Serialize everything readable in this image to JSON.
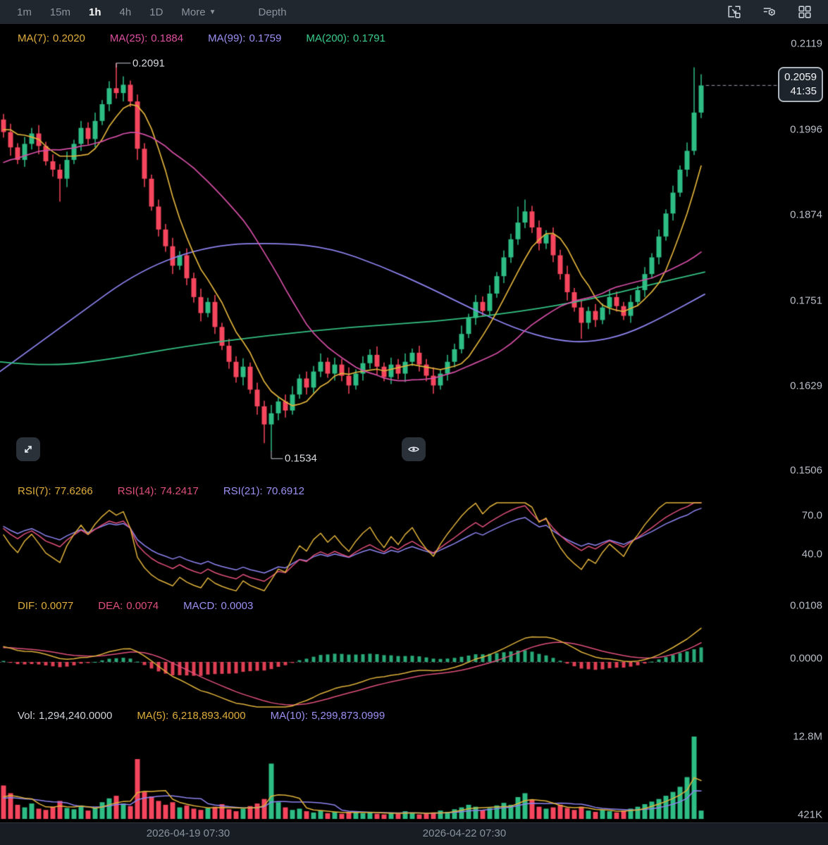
{
  "toolbar": {
    "timeframes": [
      {
        "label": "1m",
        "active": false
      },
      {
        "label": "15m",
        "active": false
      },
      {
        "label": "1h",
        "active": true
      },
      {
        "label": "4h",
        "active": false
      },
      {
        "label": "1D",
        "active": false
      }
    ],
    "more_label": "More",
    "depth_label": "Depth"
  },
  "main_chart": {
    "indicators": [
      {
        "label": "MA(7):",
        "value": "0.2020"
      },
      {
        "label": "MA(25):",
        "value": "0.1884"
      },
      {
        "label": "MA(99):",
        "value": "0.1759"
      },
      {
        "label": "MA(200):",
        "value": "0.1791"
      }
    ],
    "price_axis": [
      "0.2119",
      "0.1996",
      "0.1874",
      "0.1751",
      "0.1629",
      "0.1506"
    ],
    "annotations": {
      "high": "0.2091",
      "low": "0.1534"
    },
    "last_price": {
      "price": "0.2059",
      "countdown": "41:35"
    }
  },
  "rsi": {
    "indicators": [
      {
        "label": "RSI(7):",
        "value": "77.6266"
      },
      {
        "label": "RSI(14):",
        "value": "74.2417"
      },
      {
        "label": "RSI(21):",
        "value": "70.6912"
      }
    ],
    "axis": [
      "70.0",
      "40.0"
    ]
  },
  "macd": {
    "indicators": [
      {
        "label": "DIF:",
        "value": "0.0077"
      },
      {
        "label": "DEA:",
        "value": "0.0074"
      },
      {
        "label": "MACD:",
        "value": "0.0003"
      }
    ],
    "axis": [
      "0.0108",
      "0.0000"
    ]
  },
  "volume": {
    "indicators": [
      {
        "label": "Vol:",
        "value": "1,294,240.0000"
      },
      {
        "label": "MA(5):",
        "value": "6,218,893.4000"
      },
      {
        "label": "MA(10):",
        "value": "5,299,873.0999"
      }
    ],
    "axis": [
      "12.8M",
      "421K"
    ]
  },
  "time_axis": [
    "2026-04-19 07:30",
    "2026-04-22 07:30"
  ],
  "colors": {
    "up": "#2ebd85",
    "down": "#f6465d",
    "ma7": "#e0b23c",
    "ma25": "#d44fa6",
    "ma99": "#8d84f0",
    "ma200": "#35c183",
    "rsi7": "#e0b23c",
    "rsi14": "#e0507c",
    "rsi21": "#8d84f0",
    "dif": "#e0b23c",
    "dea": "#e0507c",
    "vol_ma5": "#e0b23c",
    "vol_ma10": "#8d84f0",
    "axis_text": "#b7bdc6",
    "annotation_line": "#c8cdd3"
  },
  "chart_data": {
    "type": "candlestick",
    "interval": "1h",
    "price_axis_values": [
      0.2119,
      0.1996,
      0.1874,
      0.1751,
      0.1629,
      0.1506
    ],
    "period_high": 0.2091,
    "period_low": 0.1534,
    "last_price": 0.2059,
    "rsi_axis_values": [
      70.0,
      40.0
    ],
    "macd_axis_values": [
      0.0108,
      0.0
    ],
    "volume_axis_max_millions": 12.8,
    "time_ticks": [
      "2026-04-19 07:30",
      "2026-04-22 07:30"
    ],
    "open": [
      0.201,
      0.1992,
      0.197,
      0.1952,
      0.1975,
      0.199,
      0.1972,
      0.195,
      0.1938,
      0.1925,
      0.1952,
      0.1975,
      0.1998,
      0.1982,
      0.2008,
      0.2032,
      0.2055,
      0.2048,
      0.206,
      0.2036,
      0.1968,
      0.1925,
      0.1885,
      0.1852,
      0.1828,
      0.18,
      0.1815,
      0.1782,
      0.1755,
      0.1732,
      0.1748,
      0.1712,
      0.1685,
      0.1662,
      0.164,
      0.1655,
      0.1622,
      0.1598,
      0.1572,
      0.1588,
      0.1605,
      0.1592,
      0.1615,
      0.1638,
      0.1625,
      0.1648,
      0.1662,
      0.1645,
      0.1658,
      0.1642,
      0.1628,
      0.1645,
      0.166,
      0.1672,
      0.1655,
      0.164,
      0.1658,
      0.1645,
      0.1662,
      0.1675,
      0.1658,
      0.1642,
      0.1628,
      0.1645,
      0.1662,
      0.168,
      0.1702,
      0.1725,
      0.1748,
      0.1735,
      0.176,
      0.1785,
      0.1812,
      0.1838,
      0.1862,
      0.1878,
      0.1855,
      0.1832,
      0.1845,
      0.1815,
      0.1788,
      0.1762,
      0.174,
      0.1718,
      0.1735,
      0.1722,
      0.174,
      0.1755,
      0.1742,
      0.1728,
      0.1748,
      0.1765,
      0.1788,
      0.1812,
      0.1842,
      0.1875,
      0.1905,
      0.1938,
      0.1965,
      0.202
    ],
    "high": [
      0.2018,
      0.2004,
      0.1976,
      0.1985,
      0.1998,
      0.2002,
      0.1978,
      0.196,
      0.1946,
      0.1964,
      0.1981,
      0.2008,
      0.2006,
      0.202,
      0.2038,
      0.2065,
      0.2091,
      0.2072,
      0.2066,
      0.2046,
      0.1976,
      0.1931,
      0.1895,
      0.186,
      0.184,
      0.1821,
      0.1825,
      0.179,
      0.1767,
      0.1754,
      0.1758,
      0.1718,
      0.1695,
      0.167,
      0.1667,
      0.1661,
      0.1632,
      0.1606,
      0.16,
      0.1611,
      0.1615,
      0.1627,
      0.1644,
      0.1648,
      0.1656,
      0.1674,
      0.1668,
      0.1668,
      0.1666,
      0.1654,
      0.1651,
      0.167,
      0.168,
      0.1684,
      0.1661,
      0.1668,
      0.1666,
      0.1674,
      0.1681,
      0.1685,
      0.1666,
      0.1654,
      0.1651,
      0.1672,
      0.1688,
      0.1714,
      0.1731,
      0.1758,
      0.1756,
      0.1772,
      0.1791,
      0.1822,
      0.1846,
      0.1885,
      0.1895,
      0.1886,
      0.1865,
      0.1851,
      0.1855,
      0.1823,
      0.18,
      0.1768,
      0.175,
      0.1741,
      0.1745,
      0.1746,
      0.1765,
      0.1763,
      0.1748,
      0.1758,
      0.1771,
      0.1798,
      0.1818,
      0.1852,
      0.1881,
      0.1915,
      0.1944,
      0.1977,
      0.2085,
      0.2075
    ],
    "low": [
      0.1984,
      0.1958,
      0.1946,
      0.1942,
      0.1967,
      0.196,
      0.1944,
      0.1928,
      0.1892,
      0.1913,
      0.1946,
      0.1965,
      0.1974,
      0.197,
      0.2002,
      0.2022,
      0.204,
      0.2036,
      0.2028,
      0.1952,
      0.1913,
      0.1879,
      0.1842,
      0.182,
      0.1788,
      0.1794,
      0.1772,
      0.1747,
      0.172,
      0.1726,
      0.1702,
      0.1679,
      0.1652,
      0.1632,
      0.1628,
      0.1616,
      0.1586,
      0.1545,
      0.1534,
      0.1578,
      0.1582,
      0.1586,
      0.1609,
      0.1615,
      0.1617,
      0.164,
      0.1639,
      0.1635,
      0.1634,
      0.1616,
      0.1622,
      0.1635,
      0.1652,
      0.1643,
      0.1634,
      0.163,
      0.1637,
      0.1633,
      0.1656,
      0.1648,
      0.1634,
      0.1616,
      0.1622,
      0.1635,
      0.1654,
      0.1674,
      0.1696,
      0.1715,
      0.1727,
      0.1729,
      0.1754,
      0.1775,
      0.1804,
      0.183,
      0.1854,
      0.1847,
      0.1822,
      0.1824,
      0.1805,
      0.178,
      0.175,
      0.1734,
      0.1695,
      0.1709,
      0.1712,
      0.1716,
      0.173,
      0.1734,
      0.1722,
      0.1718,
      0.1742,
      0.1755,
      0.1782,
      0.1802,
      0.1836,
      0.1865,
      0.1899,
      0.1928,
      0.1959,
      0.2012
    ],
    "close": [
      0.1992,
      0.197,
      0.1952,
      0.1975,
      0.199,
      0.1972,
      0.195,
      0.1938,
      0.1925,
      0.1952,
      0.1975,
      0.1998,
      0.1982,
      0.2008,
      0.2032,
      0.2055,
      0.2048,
      0.206,
      0.2036,
      0.1968,
      0.1925,
      0.1885,
      0.1852,
      0.1828,
      0.18,
      0.1815,
      0.1782,
      0.1755,
      0.1732,
      0.1748,
      0.1712,
      0.1685,
      0.1662,
      0.164,
      0.1655,
      0.1622,
      0.1598,
      0.1572,
      0.1588,
      0.1605,
      0.1592,
      0.1615,
      0.1638,
      0.1625,
      0.1648,
      0.1662,
      0.1645,
      0.1658,
      0.1642,
      0.1628,
      0.1645,
      0.166,
      0.1672,
      0.1655,
      0.164,
      0.1658,
      0.1645,
      0.1662,
      0.1675,
      0.1658,
      0.1642,
      0.1628,
      0.1645,
      0.1662,
      0.168,
      0.1702,
      0.1725,
      0.1748,
      0.1735,
      0.176,
      0.1785,
      0.1812,
      0.1838,
      0.1862,
      0.1878,
      0.1855,
      0.1832,
      0.1845,
      0.1815,
      0.1788,
      0.1762,
      0.174,
      0.1718,
      0.1735,
      0.1722,
      0.174,
      0.1755,
      0.1742,
      0.1728,
      0.1748,
      0.1765,
      0.1788,
      0.1812,
      0.1842,
      0.1875,
      0.1905,
      0.1938,
      0.1965,
      0.202,
      0.2059
    ],
    "volume_millions": [
      5.2,
      4.0,
      2.2,
      1.8,
      2.4,
      1.6,
      1.4,
      1.9,
      2.8,
      1.7,
      1.5,
      2.1,
      1.3,
      1.8,
      2.6,
      3.2,
      3.6,
      2.4,
      2.0,
      9.3,
      4.2,
      3.5,
      2.8,
      2.2,
      2.6,
      1.8,
      2.1,
      1.6,
      1.4,
      1.7,
      1.9,
      2.3,
      1.5,
      1.2,
      1.6,
      2.0,
      2.4,
      3.1,
      8.6,
      2.6,
      1.8,
      1.4,
      1.6,
      1.2,
      1.0,
      1.3,
      0.9,
      1.1,
      0.8,
      1.0,
      1.2,
      0.9,
      1.1,
      0.8,
      0.7,
      1.0,
      0.8,
      1.2,
      0.9,
      0.7,
      0.8,
      1.0,
      1.3,
      1.1,
      1.5,
      1.8,
      2.2,
      1.9,
      1.4,
      1.7,
      2.1,
      2.5,
      2.2,
      3.4,
      4.0,
      3.0,
      1.9,
      1.6,
      1.8,
      2.2,
      1.7,
      1.4,
      1.9,
      1.3,
      1.1,
      1.4,
      1.2,
      1.0,
      1.3,
      1.6,
      1.9,
      2.3,
      2.7,
      3.1,
      3.6,
      4.2,
      5.0,
      6.5,
      12.8,
      1.3
    ],
    "ma99_path": [
      [
        0,
        0.1648
      ],
      [
        100,
        0.1722
      ],
      [
        200,
        0.1795
      ],
      [
        300,
        0.183
      ],
      [
        400,
        0.1833
      ],
      [
        470,
        0.1825
      ],
      [
        540,
        0.18
      ],
      [
        610,
        0.1768
      ],
      [
        670,
        0.1738
      ],
      [
        730,
        0.171
      ],
      [
        790,
        0.1692
      ],
      [
        840,
        0.169
      ],
      [
        890,
        0.1702
      ],
      [
        940,
        0.1726
      ],
      [
        1000,
        0.1759
      ]
    ],
    "ma200_path": [
      [
        0,
        0.1662
      ],
      [
        70,
        0.1655
      ],
      [
        160,
        0.1666
      ],
      [
        260,
        0.1684
      ],
      [
        380,
        0.17
      ],
      [
        500,
        0.1712
      ],
      [
        620,
        0.172
      ],
      [
        740,
        0.1734
      ],
      [
        840,
        0.1752
      ],
      [
        920,
        0.1772
      ],
      [
        1000,
        0.1791
      ]
    ],
    "prehistory": {
      "ramp_start": 0.1872,
      "ramp_end": 0.201,
      "steps": 26,
      "zigzag": 0.001,
      "volume_fill": 3.0
    }
  }
}
